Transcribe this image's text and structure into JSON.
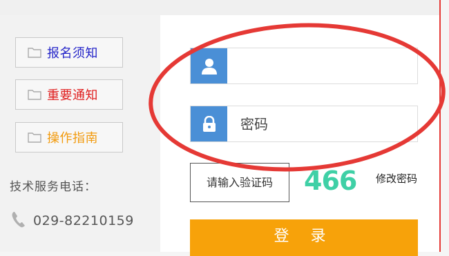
{
  "sidebar": {
    "items": [
      {
        "label": "报名须知",
        "color": "#2323c8",
        "icon": "folder-icon"
      },
      {
        "label": "重要通知",
        "color": "#e01f1f",
        "icon": "folder-icon"
      },
      {
        "label": "操作指南",
        "color": "#f29a0c",
        "icon": "folder-icon"
      }
    ],
    "support_label": "技术服务电话：",
    "phone_number": "029-82210159",
    "phone_icon": "phone-icon"
  },
  "login_form": {
    "username": {
      "value": "",
      "placeholder": "",
      "icon": "user-icon"
    },
    "password": {
      "value": "",
      "placeholder": "密码",
      "icon": "lock-icon"
    },
    "captcha": {
      "placeholder": "请输入验证码",
      "code": "466"
    },
    "change_password_label": "修改密码",
    "login_label": "登 录"
  },
  "colors": {
    "accent_blue": "#4a8fd6",
    "login_button": "#f7a20a",
    "captcha_green": "#3fd0a6",
    "annotation_red": "#e53935"
  }
}
